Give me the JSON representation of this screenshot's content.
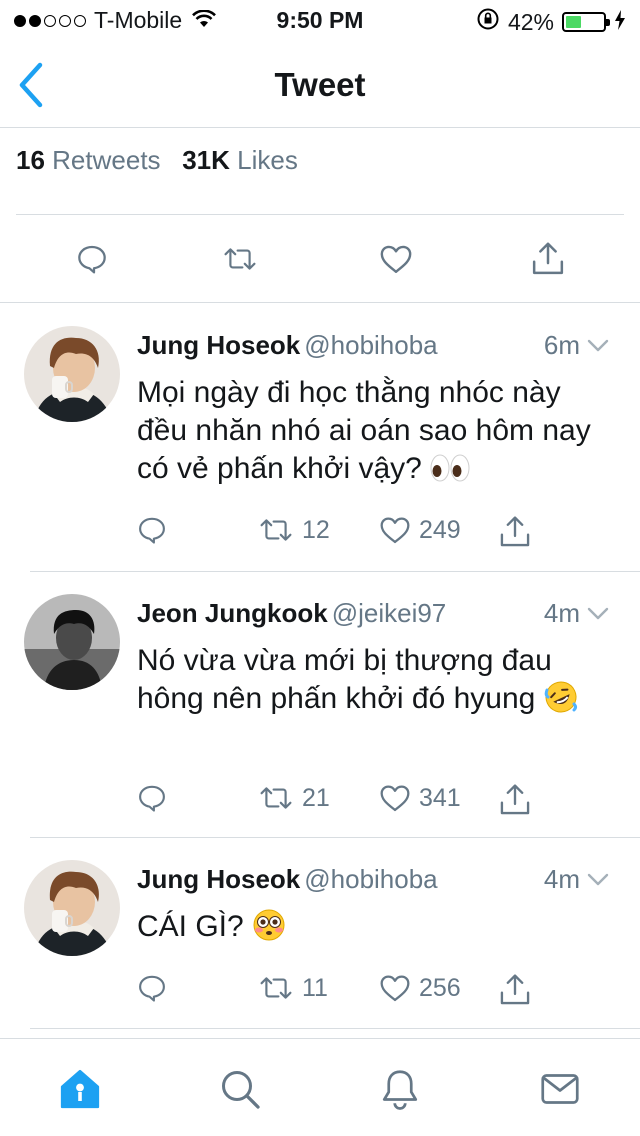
{
  "status": {
    "carrier": "T-Mobile",
    "time": "9:50 PM",
    "battery": "42%",
    "battery_level": 0.42
  },
  "nav": {
    "title": "Tweet"
  },
  "stats": {
    "retweets_count": "16",
    "retweets_label": "Retweets",
    "likes_count": "31K",
    "likes_label": "Likes"
  },
  "replies": [
    {
      "name": "Jung Hoseok",
      "handle": "@hobihoba",
      "time": "6m",
      "text": "Mọi ngày đi học thằng nhóc này đều nhăn nhó ai oán sao hôm nay có vẻ phấn khởi vậy?",
      "emoji": "eyes",
      "retweets": "12",
      "likes": "249"
    },
    {
      "name": "Jeon Jungkook",
      "handle": "@jeikei97",
      "time": "4m",
      "text": "Nó vừa vừa mới bị thượng đau hông nên phấn khởi đó hyung",
      "emoji": "rolling-on-floor-laughing",
      "retweets": "21",
      "likes": "341"
    },
    {
      "name": "Jung Hoseok",
      "handle": "@hobihoba",
      "time": "4m",
      "text": "CÁI GÌ?",
      "emoji": "flushed-face",
      "retweets": "11",
      "likes": "256"
    }
  ],
  "colors": {
    "accent": "#1da1f2",
    "secondary_text": "#657786",
    "divider": "#d8dde1",
    "battery": "#4cd964"
  }
}
